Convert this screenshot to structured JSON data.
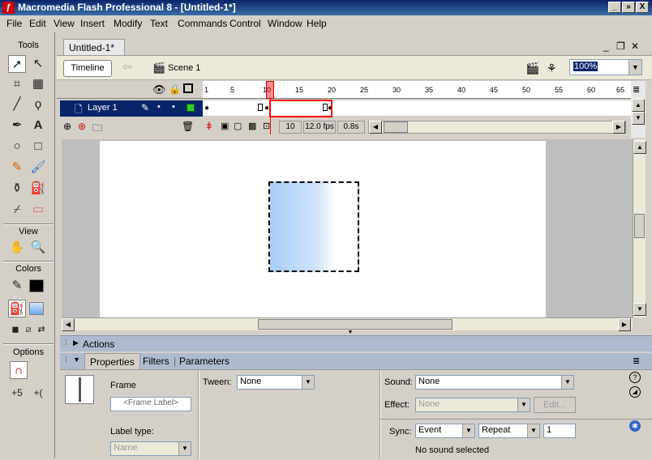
{
  "window": {
    "title": "Macromedia Flash Professional 8 - [Untitled-1*]",
    "buttons": [
      "_",
      "»",
      "X"
    ]
  },
  "menu": [
    "File",
    "Edit",
    "View",
    "Insert",
    "Modify",
    "Text",
    "Commands",
    "Control",
    "Window",
    "Help"
  ],
  "tools": {
    "header": "Tools",
    "view_header": "View",
    "colors_header": "Colors",
    "options_header": "Options"
  },
  "document": {
    "tab": "Untitled-1*",
    "timeline_button": "Timeline",
    "scene": "Scene 1",
    "zoom": "100%"
  },
  "timeline": {
    "ruler": [
      "1",
      "5",
      "10",
      "15",
      "20",
      "25",
      "30",
      "35",
      "40",
      "45",
      "50",
      "55",
      "60",
      "65"
    ],
    "layer_name": "Layer 1",
    "current_frame": "10",
    "fps": "12.0 fps",
    "elapsed": "0.8s"
  },
  "panels": {
    "actions": "Actions",
    "tabs": [
      "Properties",
      "Filters",
      "Parameters"
    ]
  },
  "properties": {
    "frame_label": "Frame",
    "frame_placeholder": "<Frame Label>",
    "label_type_label": "Label type:",
    "label_type_value": "Name",
    "tween_label": "Tween:",
    "tween_value": "None",
    "sound_label": "Sound:",
    "sound_value": "None",
    "effect_label": "Effect:",
    "effect_value": "None",
    "edit_button": "Edit...",
    "sync_label": "Sync:",
    "sync_value": "Event",
    "repeat_value": "Repeat",
    "repeat_count": "1",
    "status": "No sound selected"
  }
}
